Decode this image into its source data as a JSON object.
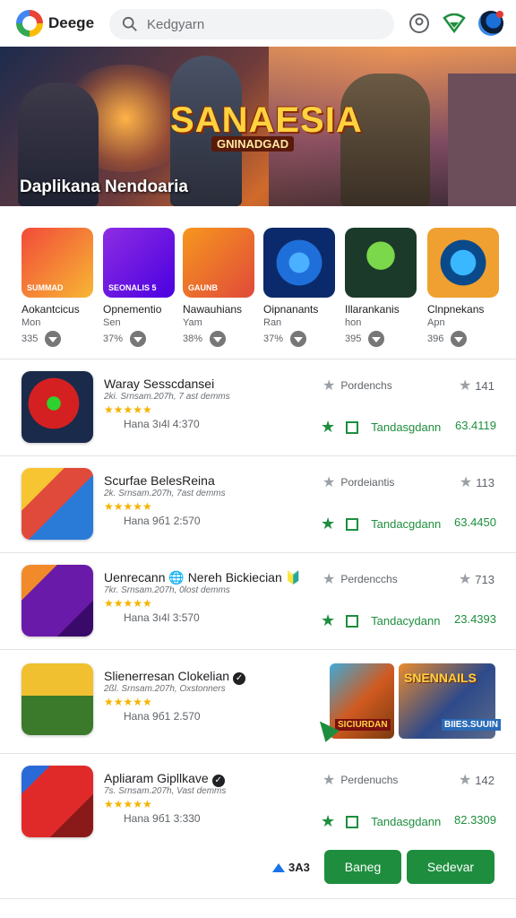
{
  "app": {
    "brand": "Deege"
  },
  "search": {
    "placeholder": "Kedgyarn"
  },
  "hero": {
    "title": "SANAESIA",
    "subtitle": "GNINADGAD",
    "caption": "Daplikana Nendoaria"
  },
  "featured": [
    {
      "title": "Aokantcicus",
      "sub": "Mon",
      "count": "335",
      "badge": "SUMMAD",
      "colors": [
        "#f24a3a",
        "#f7b733"
      ]
    },
    {
      "title": "Opnementio",
      "sub": "Sen",
      "count": "37%",
      "badge": "SEONALIS 5",
      "colors": [
        "#8e2de2",
        "#4a00e0"
      ]
    },
    {
      "title": "Nawauhians",
      "sub": "Yam",
      "count": "38%",
      "badge": "GAUNB",
      "colors": [
        "#f7971e",
        "#e04a3a"
      ]
    },
    {
      "title": "Oipnanants",
      "sub": "Ran",
      "count": "37%",
      "badge": "",
      "colors": [
        "#1e6fd9",
        "#0b2a6b"
      ]
    },
    {
      "title": "Illarankanis",
      "sub": "hon",
      "count": "395",
      "badge": "",
      "colors": [
        "#1b3a2a",
        "#3aa84a"
      ]
    },
    {
      "title": "Clnpnekans",
      "sub": "Apn",
      "count": "396",
      "badge": "",
      "colors": [
        "#0a4a8a",
        "#f0a030"
      ]
    }
  ],
  "list": [
    {
      "name": "Waray Sesscdansei",
      "meta": "2ki. Srnsam.207h, 7 ast demms",
      "stars": "★★★★★",
      "info": "Hana  3ı4l   4:370",
      "publisher": "Pordenchs",
      "count": "141",
      "action": "Tandasgdann",
      "price": "63.4119",
      "colors": [
        "#d42020",
        "#1a2a4a"
      ],
      "verified": false
    },
    {
      "name": "Scurfae BelesReina",
      "meta": "2k. Srnsam.207h, 7ast demms",
      "stars": "★★★★★",
      "info": "Hana  9б1   2:570",
      "publisher": "Pordeiantis",
      "count": "113",
      "action": "Tandacgdann",
      "price": "63.4450",
      "colors": [
        "#f7c531",
        "#2a7ad8"
      ],
      "verified": false
    },
    {
      "name": "Uenrecann 🌐 Nereh Bickiecian 🔰",
      "meta": "7kr. Srnsam.207h, 0lost demms",
      "stars": "★★★★★",
      "info": "Hana  3ı4l   3:570",
      "publisher": "Perdencchs",
      "count": "713",
      "action": "Tandacydann",
      "price": "23.4393",
      "colors": [
        "#6a1aa8",
        "#f08a2a"
      ],
      "verified": false
    },
    {
      "name": "Slienerresan Clokelian",
      "meta": "2ßl. Srnsam.207h, Oxstonners",
      "stars": "★★★★★",
      "info": "Hana  9б1   2.570",
      "publisher": "",
      "count": "",
      "action": "",
      "price": "",
      "colors": [
        "#f0c030",
        "#3a7a2a"
      ],
      "verified": true
    },
    {
      "name": "Apliaram Gipllkave",
      "meta": "7s. Srnsam.207h, Vast demms",
      "stars": "★★★★★",
      "info": "Hana  9б1   3:330",
      "publisher": "Perdenuchs",
      "count": "142",
      "action": "Tandasgdann",
      "price": "82.3309",
      "colors": [
        "#e02a2a",
        "#2a6ad8"
      ],
      "verified": true
    }
  ],
  "promo": {
    "left_badge": "SICIURDAN",
    "right_title": "SNENNAILS",
    "right_badge": "BIIES.SUUIN"
  },
  "bottom": {
    "count": "3A3",
    "btn1": "Baneg",
    "btn2": "Sedevar"
  }
}
